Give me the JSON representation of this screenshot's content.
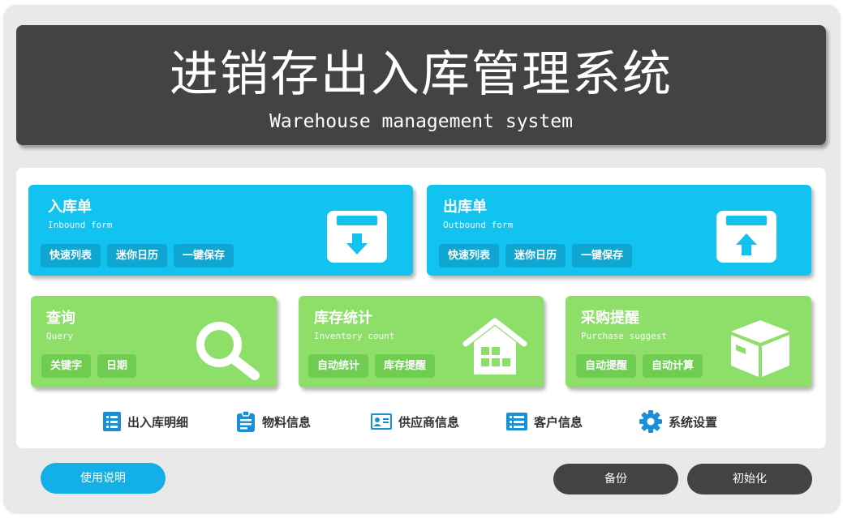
{
  "header": {
    "title": "进销存出入库管理系统",
    "subtitle": "Warehouse management system"
  },
  "cards": {
    "inbound": {
      "title": "入库单",
      "subtitle": "Inbound form",
      "buttons": [
        "快速列表",
        "迷你日历",
        "一键保存"
      ],
      "icon": "box-download-icon"
    },
    "outbound": {
      "title": "出库单",
      "subtitle": "Outbound form",
      "buttons": [
        "快速列表",
        "迷你日历",
        "一键保存"
      ],
      "icon": "box-upload-icon"
    },
    "query": {
      "title": "查询",
      "subtitle": "Query",
      "buttons": [
        "关键字",
        "日期"
      ],
      "icon": "magnifier-icon"
    },
    "inventory": {
      "title": "库存统计",
      "subtitle": "Inventory count",
      "buttons": [
        "自动统计",
        "库存提醒"
      ],
      "icon": "warehouse-icon"
    },
    "purchase": {
      "title": "采购提醒",
      "subtitle": "Purchase suggest",
      "buttons": [
        "自动提醒",
        "自动计算"
      ],
      "icon": "package-icon"
    }
  },
  "nav": [
    {
      "label": "出入库明细",
      "icon": "list-icon"
    },
    {
      "label": "物料信息",
      "icon": "clipboard-icon"
    },
    {
      "label": "供应商信息",
      "icon": "id-card-icon"
    },
    {
      "label": "客户信息",
      "icon": "list-icon"
    },
    {
      "label": "系统设置",
      "icon": "gear-icon"
    }
  ],
  "footer": {
    "help": "使用说明",
    "backup": "备份",
    "init": "初始化"
  },
  "colors": {
    "blue": "#12c2ef",
    "green": "#8ddf6a",
    "dark": "#434343",
    "nav_icon": "#1a8fd8"
  }
}
